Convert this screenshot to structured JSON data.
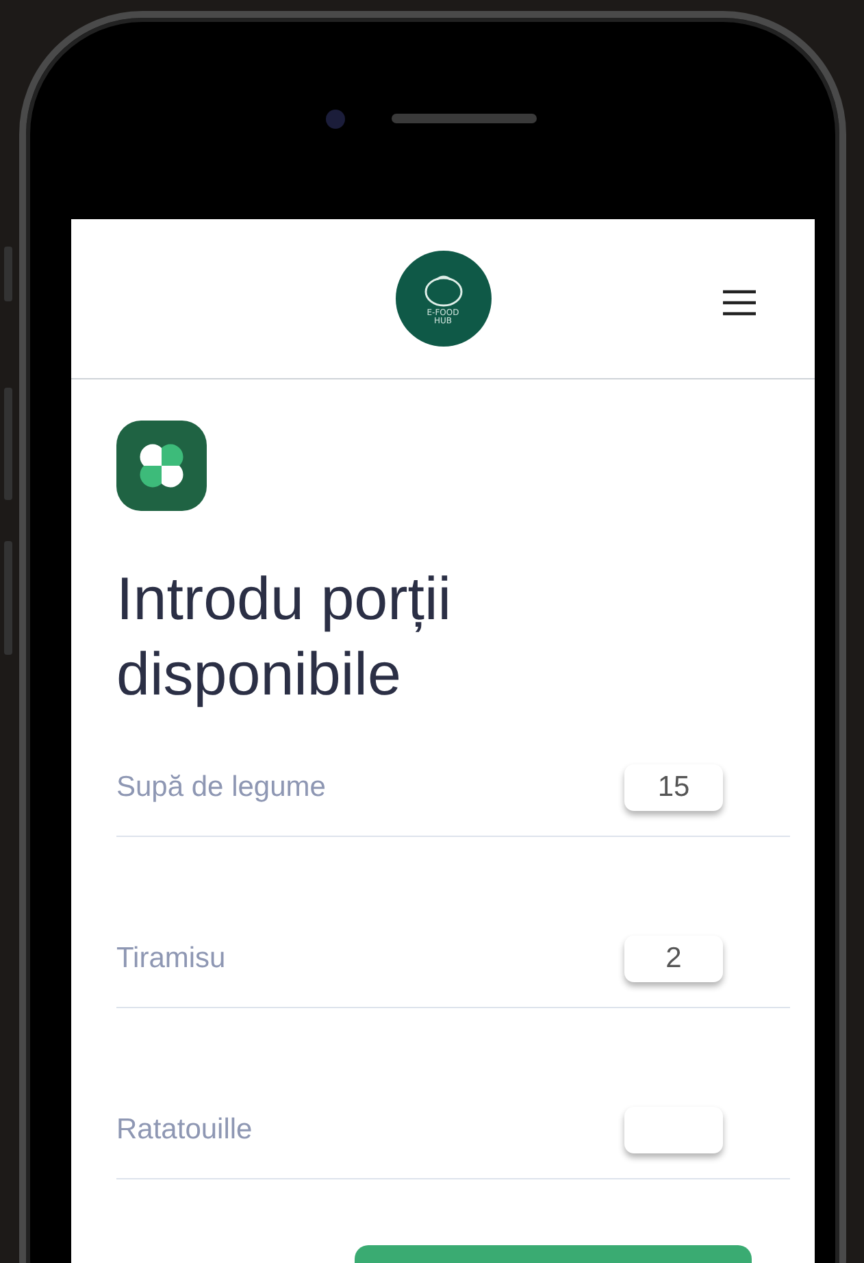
{
  "header": {
    "logo_text": "E-FOOD HUB"
  },
  "page": {
    "title": "Introdu porții disponibile"
  },
  "items": [
    {
      "name": "Supă de legume",
      "portions": "15"
    },
    {
      "name": "Tiramisu",
      "portions": "2"
    },
    {
      "name": "Ratatouille"
    }
  ]
}
